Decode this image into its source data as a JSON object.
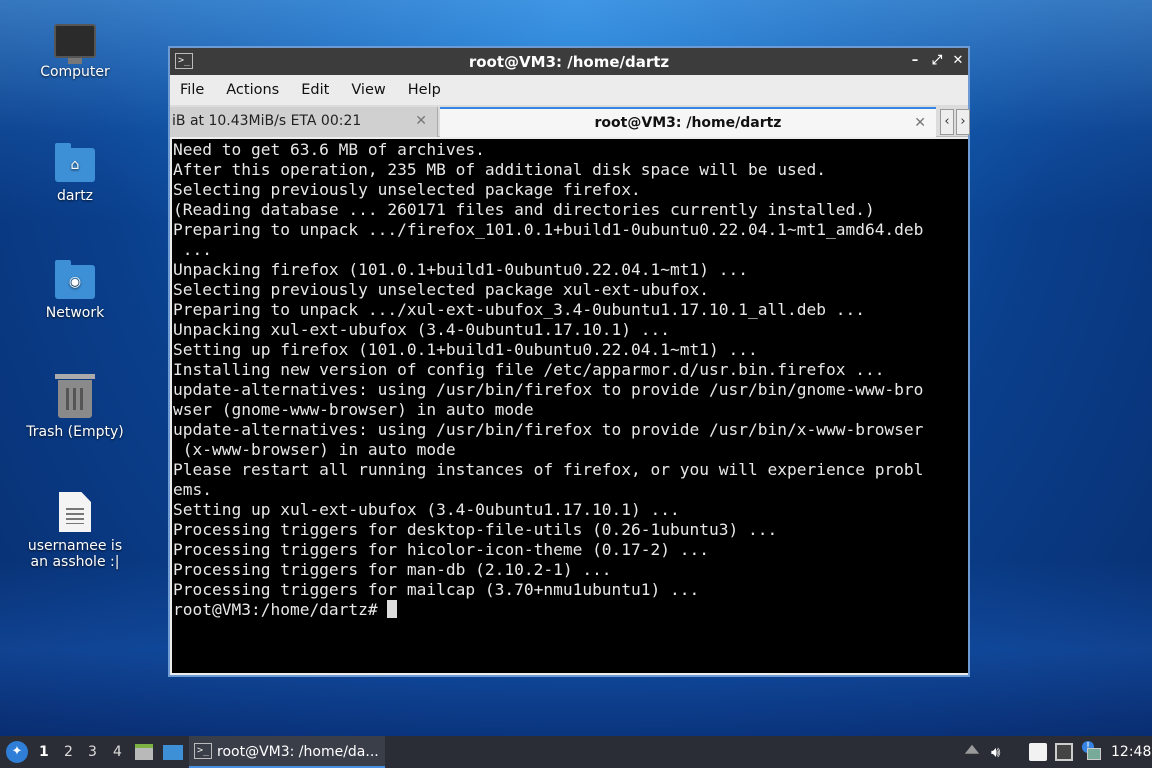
{
  "desktop": {
    "icons": [
      {
        "label": "Computer"
      },
      {
        "label": "dartz"
      },
      {
        "label": "Network"
      },
      {
        "label": "Trash (Empty)"
      },
      {
        "label": "usernamee is an asshole :|"
      }
    ]
  },
  "window": {
    "title": "root@VM3: /home/dartz",
    "menu": [
      "File",
      "Actions",
      "Edit",
      "View",
      "Help"
    ],
    "tabs": [
      {
        "label": "iB at 10.43MiB/s ETA 00:21"
      },
      {
        "label": "root@VM3: /home/dartz"
      }
    ],
    "terminal_lines": [
      "Need to get 63.6 MB of archives.",
      "After this operation, 235 MB of additional disk space will be used.",
      "Selecting previously unselected package firefox.",
      "(Reading database ... 260171 files and directories currently installed.)",
      "Preparing to unpack .../firefox_101.0.1+build1-0ubuntu0.22.04.1~mt1_amd64.deb",
      " ...",
      "Unpacking firefox (101.0.1+build1-0ubuntu0.22.04.1~mt1) ...",
      "Selecting previously unselected package xul-ext-ubufox.",
      "Preparing to unpack .../xul-ext-ubufox_3.4-0ubuntu1.17.10.1_all.deb ...",
      "Unpacking xul-ext-ubufox (3.4-0ubuntu1.17.10.1) ...",
      "Setting up firefox (101.0.1+build1-0ubuntu0.22.04.1~mt1) ...",
      "Installing new version of config file /etc/apparmor.d/usr.bin.firefox ...",
      "update-alternatives: using /usr/bin/firefox to provide /usr/bin/gnome-www-bro",
      "wser (gnome-www-browser) in auto mode",
      "update-alternatives: using /usr/bin/firefox to provide /usr/bin/x-www-browser",
      " (x-www-browser) in auto mode",
      "Please restart all running instances of firefox, or you will experience probl",
      "ems.",
      "Setting up xul-ext-ubufox (3.4-0ubuntu1.17.10.1) ...",
      "Processing triggers for desktop-file-utils (0.26-1ubuntu3) ...",
      "Processing triggers for hicolor-icon-theme (0.17-2) ...",
      "Processing triggers for man-db (2.10.2-1) ...",
      "Processing triggers for mailcap (3.70+nmu1ubuntu1) ..."
    ],
    "prompt": "root@VM3:/home/dartz# "
  },
  "taskbar": {
    "workspaces": [
      "1",
      "2",
      "3",
      "4"
    ],
    "task_label": "root@VM3: /home/da...",
    "clock": "12:48"
  }
}
